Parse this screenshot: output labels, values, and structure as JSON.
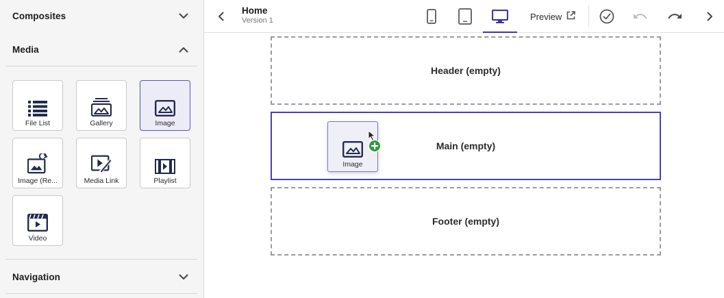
{
  "sidebar": {
    "sections": [
      {
        "title": "Composites",
        "expanded": false
      },
      {
        "title": "Media",
        "expanded": true
      },
      {
        "title": "Navigation",
        "expanded": false
      }
    ],
    "media_items": [
      {
        "label": "File List",
        "icon": "file-list-icon",
        "selected": false
      },
      {
        "label": "Gallery",
        "icon": "gallery-icon",
        "selected": false
      },
      {
        "label": "Image",
        "icon": "image-icon",
        "selected": true
      },
      {
        "label": "Image (Re...",
        "icon": "image-responsive-icon",
        "selected": false
      },
      {
        "label": "Media Link",
        "icon": "media-link-icon",
        "selected": false
      },
      {
        "label": "Playlist",
        "icon": "playlist-icon",
        "selected": false
      },
      {
        "label": "Video",
        "icon": "video-icon",
        "selected": false
      }
    ]
  },
  "topbar": {
    "page_title": "Home",
    "version": "Version 1",
    "devices": [
      {
        "name": "phone",
        "icon": "phone-icon",
        "active": false
      },
      {
        "name": "tablet",
        "icon": "tablet-icon",
        "active": false
      },
      {
        "name": "desktop",
        "icon": "desktop-icon",
        "active": true
      }
    ],
    "preview_label": "Preview",
    "icons": [
      "back-chevron-icon",
      "external-link-icon",
      "check-circle-icon",
      "undo-icon",
      "redo-icon",
      "forward-chevron-icon"
    ]
  },
  "canvas": {
    "zones": [
      {
        "label": "Header (empty)",
        "active": false
      },
      {
        "label": "Main (empty)",
        "active": true
      },
      {
        "label": "Footer (empty)",
        "active": false
      }
    ],
    "drag_ghost": {
      "label": "Image",
      "icon": "image-icon",
      "badge": "plus-icon"
    }
  },
  "colors": {
    "accent": "#3f34a8",
    "selected_tile_bg": "#ececf7",
    "drop_badge": "#2f9a3c",
    "sidebar_bg": "#f5f5f5"
  }
}
